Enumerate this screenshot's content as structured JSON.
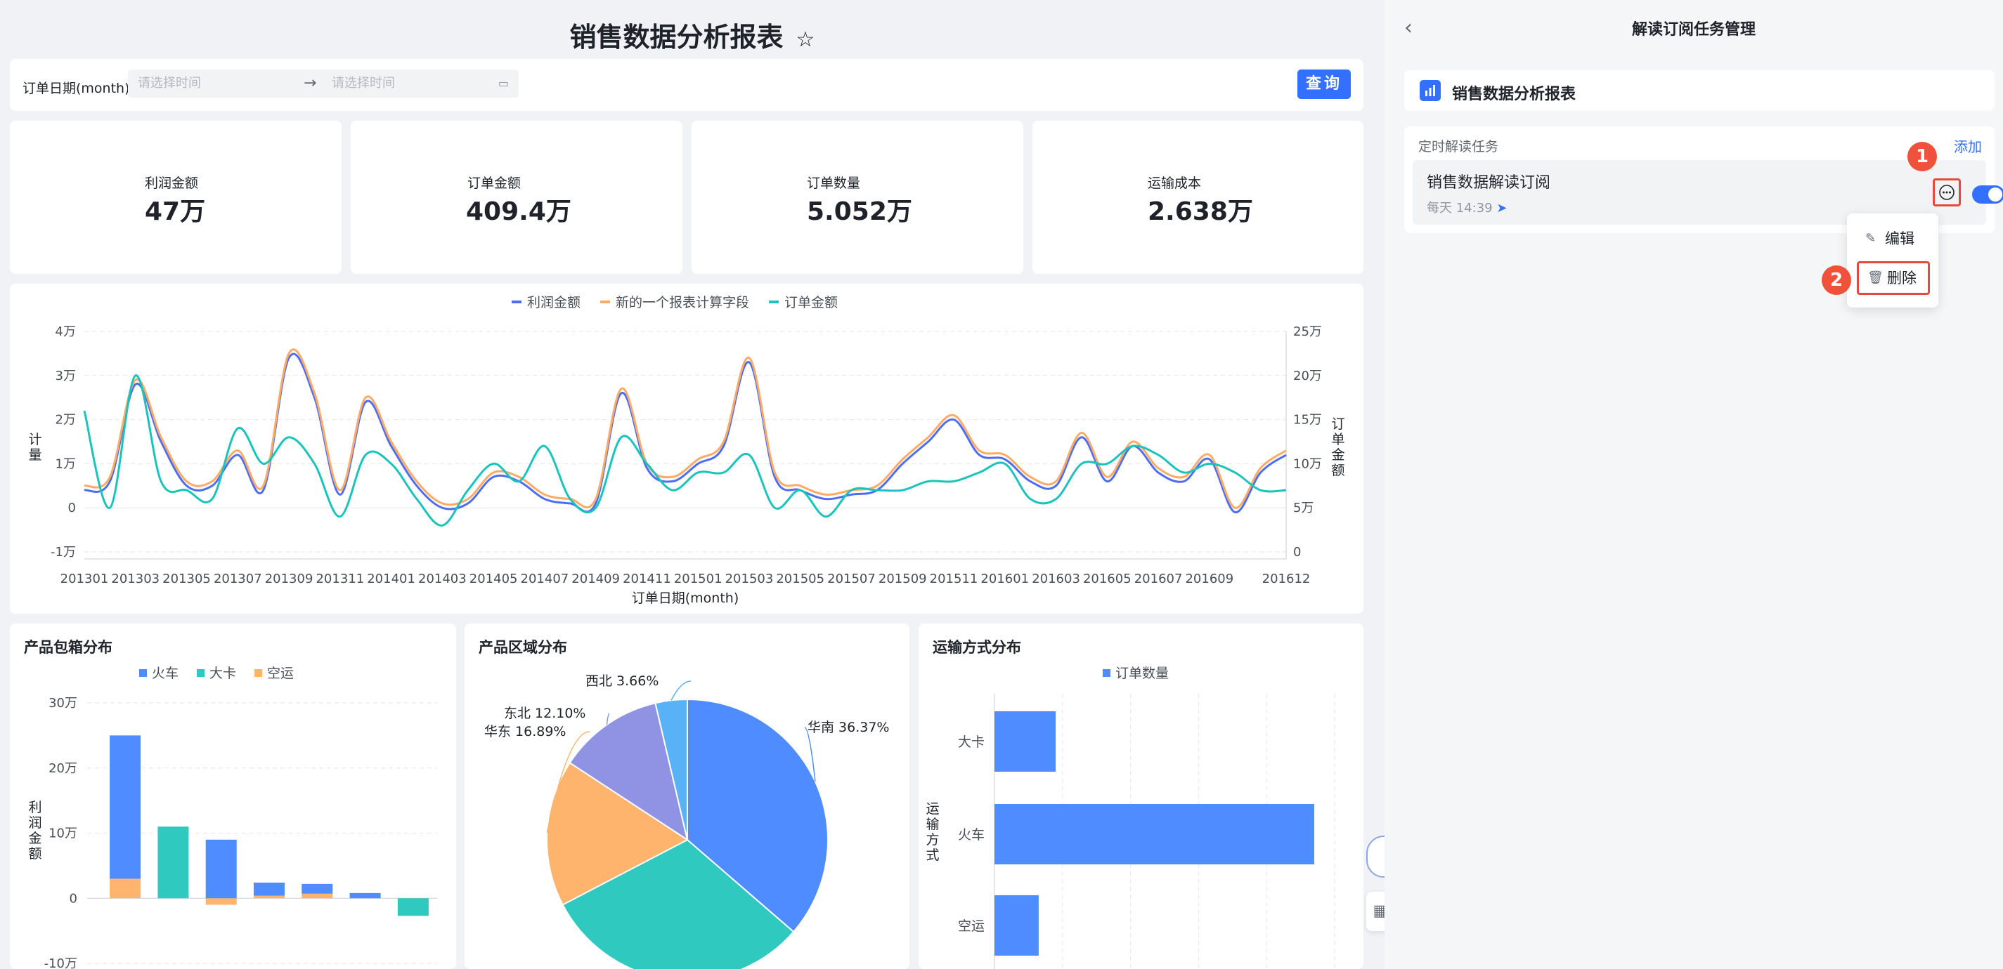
{
  "page": {
    "title": "销售数据分析报表"
  },
  "filter": {
    "label": "订单日期(month)",
    "start_placeholder": "请选择时间",
    "end_placeholder": "请选择时间",
    "arrow": "→",
    "query_label": "查询"
  },
  "kpis": [
    {
      "label": "利润金额",
      "value": "47万"
    },
    {
      "label": "订单金额",
      "value": "409.4万"
    },
    {
      "label": "订单数量",
      "value": "5.052万"
    },
    {
      "label": "运输成本",
      "value": "2.638万"
    }
  ],
  "charts": {
    "box_title": "产品包箱分布",
    "region_title": "产品区域分布",
    "ship_title": "运输方式分布"
  },
  "chart_data": [
    {
      "type": "line",
      "legend": [
        "利润金额",
        "新的一个报表计算字段",
        "订单金额"
      ],
      "xlabel": "订单日期(month)",
      "ylabel": "计量",
      "y2label": "订单金额",
      "ylim": [
        -1,
        4
      ],
      "y2lim": [
        0,
        25
      ],
      "yticks": [
        "-1万",
        "0",
        "1万",
        "2万",
        "3万",
        "4万"
      ],
      "y2ticks": [
        "0",
        "5万",
        "10万",
        "15万",
        "20万",
        "25万"
      ],
      "xticks": [
        "201301",
        "201303",
        "201305",
        "201307",
        "201309",
        "201311",
        "201401",
        "201403",
        "201405",
        "201407",
        "201409",
        "201411",
        "201501",
        "201503",
        "201505",
        "201507",
        "201509",
        "201511",
        "201601",
        "201603",
        "201605",
        "201607",
        "201609",
        "201612"
      ],
      "series": [
        {
          "name": "利润金额",
          "color": "#4e6ef2",
          "axis": "left",
          "values": [
            0.4,
            0.6,
            2.8,
            1.5,
            0.5,
            0.5,
            1.2,
            0.4,
            3.4,
            2.5,
            0.3,
            2.4,
            1.4,
            0.5,
            0.0,
            0.1,
            0.7,
            0.6,
            0.2,
            0.1,
            0.1,
            2.6,
            0.9,
            0.6,
            1.0,
            1.4,
            3.3,
            0.7,
            0.4,
            0.2,
            0.3,
            0.4,
            1.0,
            1.5,
            2.0,
            1.2,
            1.1,
            0.6,
            0.5,
            1.6,
            0.6,
            1.4,
            0.8,
            0.6,
            1.1,
            -0.1,
            0.8,
            1.2
          ]
        },
        {
          "name": "新的一个报表计算字段",
          "color": "#ffab66",
          "axis": "left",
          "values": [
            0.5,
            0.7,
            2.9,
            1.6,
            0.6,
            0.6,
            1.3,
            0.5,
            3.5,
            2.6,
            0.4,
            2.5,
            1.5,
            0.6,
            0.1,
            0.2,
            0.8,
            0.7,
            0.3,
            0.2,
            0.2,
            2.7,
            1.0,
            0.7,
            1.1,
            1.5,
            3.4,
            0.8,
            0.5,
            0.3,
            0.4,
            0.5,
            1.1,
            1.6,
            2.1,
            1.3,
            1.2,
            0.7,
            0.6,
            1.7,
            0.7,
            1.5,
            0.9,
            0.7,
            1.2,
            0.0,
            0.9,
            1.3
          ]
        },
        {
          "name": "订单金额",
          "color": "#1bc4bb",
          "axis": "right",
          "values": [
            16,
            5,
            20,
            8,
            7,
            6,
            14,
            10,
            13,
            10,
            4,
            11,
            10,
            6,
            3,
            7,
            10,
            8,
            12,
            6,
            5,
            13,
            10,
            7,
            9,
            9,
            11,
            5,
            7,
            4,
            7,
            7,
            7,
            8,
            8,
            9,
            10,
            6,
            6,
            10,
            10,
            12,
            11,
            9,
            10,
            9,
            7,
            7
          ]
        }
      ]
    },
    {
      "type": "bar",
      "stacked": true,
      "legend": [
        "火车",
        "大卡",
        "空运"
      ],
      "ylabel": "利润金额",
      "ylim": [
        -10,
        30
      ],
      "yticks": [
        "-10万",
        "0",
        "10万",
        "20万",
        "30万"
      ],
      "series": [
        {
          "name": "火车",
          "color": "#4e8cff",
          "values": [
            22,
            0,
            9,
            2,
            1.5,
            0.8,
            0
          ]
        },
        {
          "name": "大卡",
          "color": "#2fc9c0",
          "values": [
            0,
            11,
            0,
            0,
            0,
            0,
            -2.7
          ]
        },
        {
          "name": "空运",
          "color": "#ffb46e",
          "values": [
            3,
            0,
            -1,
            0.4,
            0.7,
            0,
            0
          ]
        }
      ]
    },
    {
      "type": "pie",
      "slices": [
        {
          "label": "华南 36.37%",
          "value": 36.37,
          "color": "#4e8cff"
        },
        {
          "label": "",
          "value": 30.98,
          "color": "#2fc9c0"
        },
        {
          "label": "华东 16.89%",
          "value": 16.89,
          "color": "#ffb46e"
        },
        {
          "label": "东北 12.10%",
          "value": 12.1,
          "color": "#9093e4"
        },
        {
          "label": "西北 3.66%",
          "value": 3.66,
          "color": "#58b2f5"
        }
      ]
    },
    {
      "type": "bar",
      "orientation": "horizontal",
      "legend": [
        "订单数量"
      ],
      "ylabel": "运输方式",
      "categories": [
        "大卡",
        "火车",
        "空运"
      ],
      "values": [
        0.9,
        4.7,
        0.65
      ],
      "color": "#4e8cff"
    }
  ],
  "panel": {
    "title": "解读订阅任务管理",
    "report_name": "销售数据分析报表",
    "section_label": "定时解读任务",
    "add_label": "添加",
    "task_name": "销售数据解读订阅",
    "task_time": "每天 14:39",
    "menu_edit": "编辑",
    "menu_delete": "删除",
    "step1": "1",
    "step2": "2"
  }
}
